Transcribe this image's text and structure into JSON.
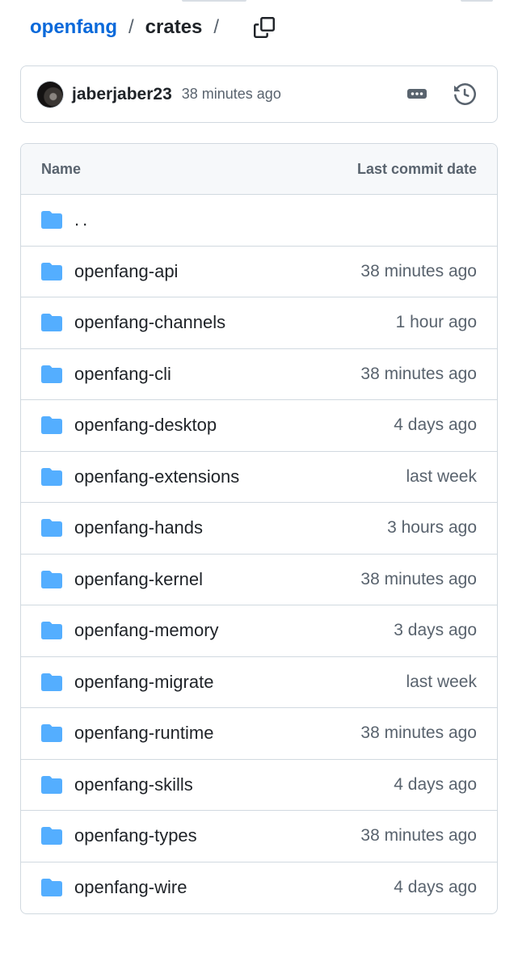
{
  "breadcrumb": {
    "repo": "openfang",
    "separator": "/",
    "current": "crates",
    "trailing_separator": "/"
  },
  "copy_icon": "copy-icon",
  "latest_commit": {
    "author": "jaberjaber23",
    "time": "38 minutes ago"
  },
  "table": {
    "header_name": "Name",
    "header_date": "Last commit date",
    "parent_dir": "..",
    "rows": [
      {
        "name": "openfang-api",
        "date": "38 minutes ago"
      },
      {
        "name": "openfang-channels",
        "date": "1 hour ago"
      },
      {
        "name": "openfang-cli",
        "date": "38 minutes ago"
      },
      {
        "name": "openfang-desktop",
        "date": "4 days ago"
      },
      {
        "name": "openfang-extensions",
        "date": "last week"
      },
      {
        "name": "openfang-hands",
        "date": "3 hours ago"
      },
      {
        "name": "openfang-kernel",
        "date": "38 minutes ago"
      },
      {
        "name": "openfang-memory",
        "date": "3 days ago"
      },
      {
        "name": "openfang-migrate",
        "date": "last week"
      },
      {
        "name": "openfang-runtime",
        "date": "38 minutes ago"
      },
      {
        "name": "openfang-skills",
        "date": "4 days ago"
      },
      {
        "name": "openfang-types",
        "date": "38 minutes ago"
      },
      {
        "name": "openfang-wire",
        "date": "4 days ago"
      }
    ]
  },
  "colors": {
    "link": "#0969da",
    "folder": "#54aeff",
    "muted": "#59636e",
    "border": "#d1d9e0"
  }
}
